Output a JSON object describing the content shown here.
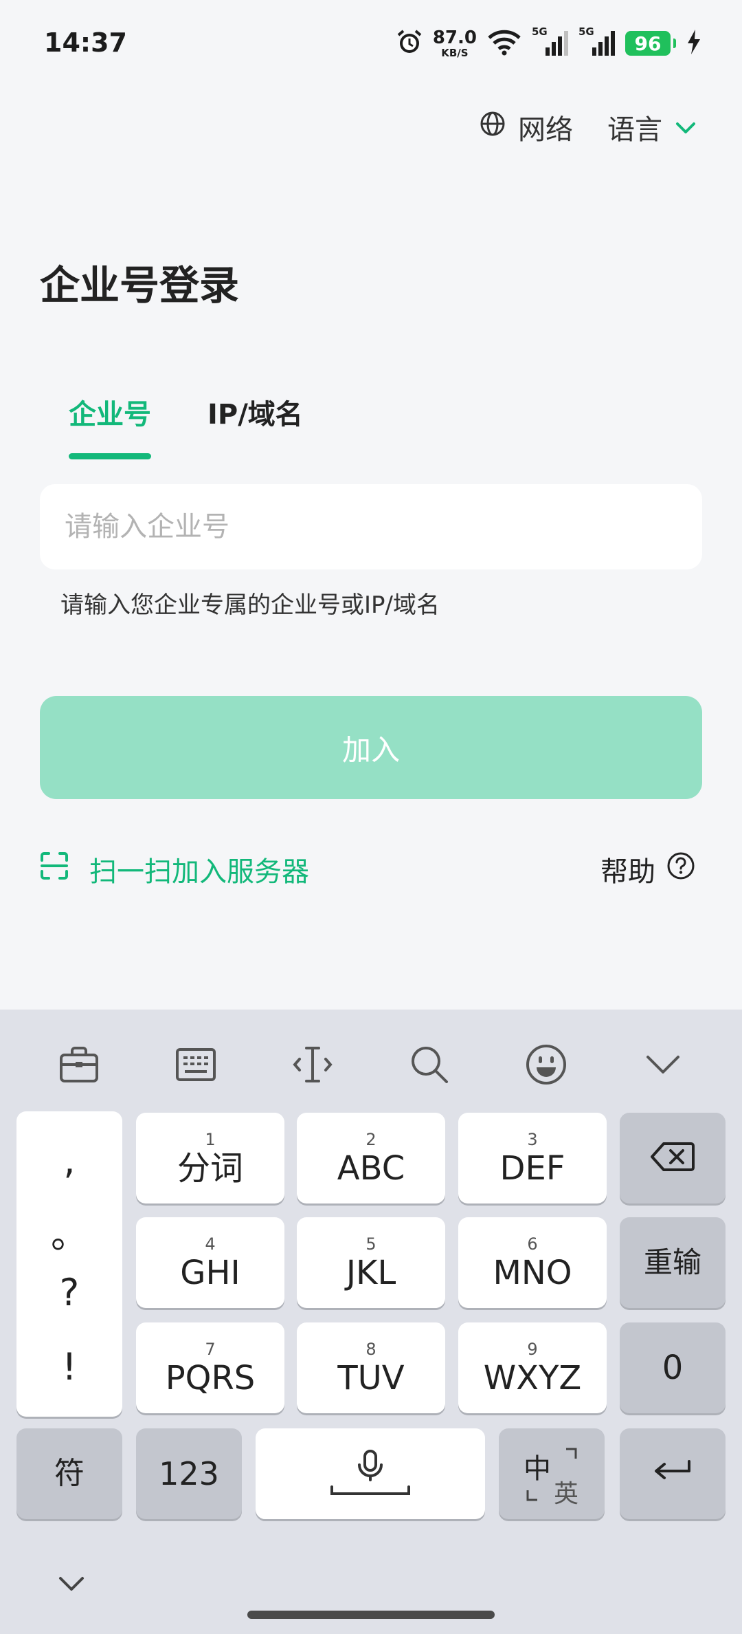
{
  "status": {
    "time": "14:37",
    "net_speed_value": "87.0",
    "net_speed_unit": "KB/S",
    "signal1_label": "5G",
    "signal2_label": "5G",
    "battery": "96"
  },
  "top": {
    "network_label": "网络",
    "language_label": "语言"
  },
  "page": {
    "title": "企业号登录",
    "tabs": [
      {
        "label": "企业号"
      },
      {
        "label": "IP/域名"
      }
    ],
    "input_placeholder": "请输入企业号",
    "hint": "请输入您企业专属的企业号或IP/域名",
    "join_label": "加入",
    "scan_label": "扫一扫加入服务器",
    "help_label": "帮助"
  },
  "keyboard": {
    "punct": [
      ",",
      "。",
      "?",
      "!"
    ],
    "keys": [
      {
        "num": "1",
        "label": "分词"
      },
      {
        "num": "2",
        "label": "ABC"
      },
      {
        "num": "3",
        "label": "DEF"
      },
      {
        "num": "4",
        "label": "GHI"
      },
      {
        "num": "5",
        "label": "JKL"
      },
      {
        "num": "6",
        "label": "MNO"
      },
      {
        "num": "7",
        "label": "PQRS"
      },
      {
        "num": "8",
        "label": "TUV"
      },
      {
        "num": "9",
        "label": "WXYZ"
      }
    ],
    "reinput_label": "重输",
    "zero_label": "0",
    "symbol_label": "符",
    "numeric_label": "123",
    "lang_zh": "中",
    "lang_en": "英"
  },
  "colors": {
    "accent": "#12b87a",
    "button_disabled": "#95e0c5",
    "battery": "#20c05c"
  }
}
